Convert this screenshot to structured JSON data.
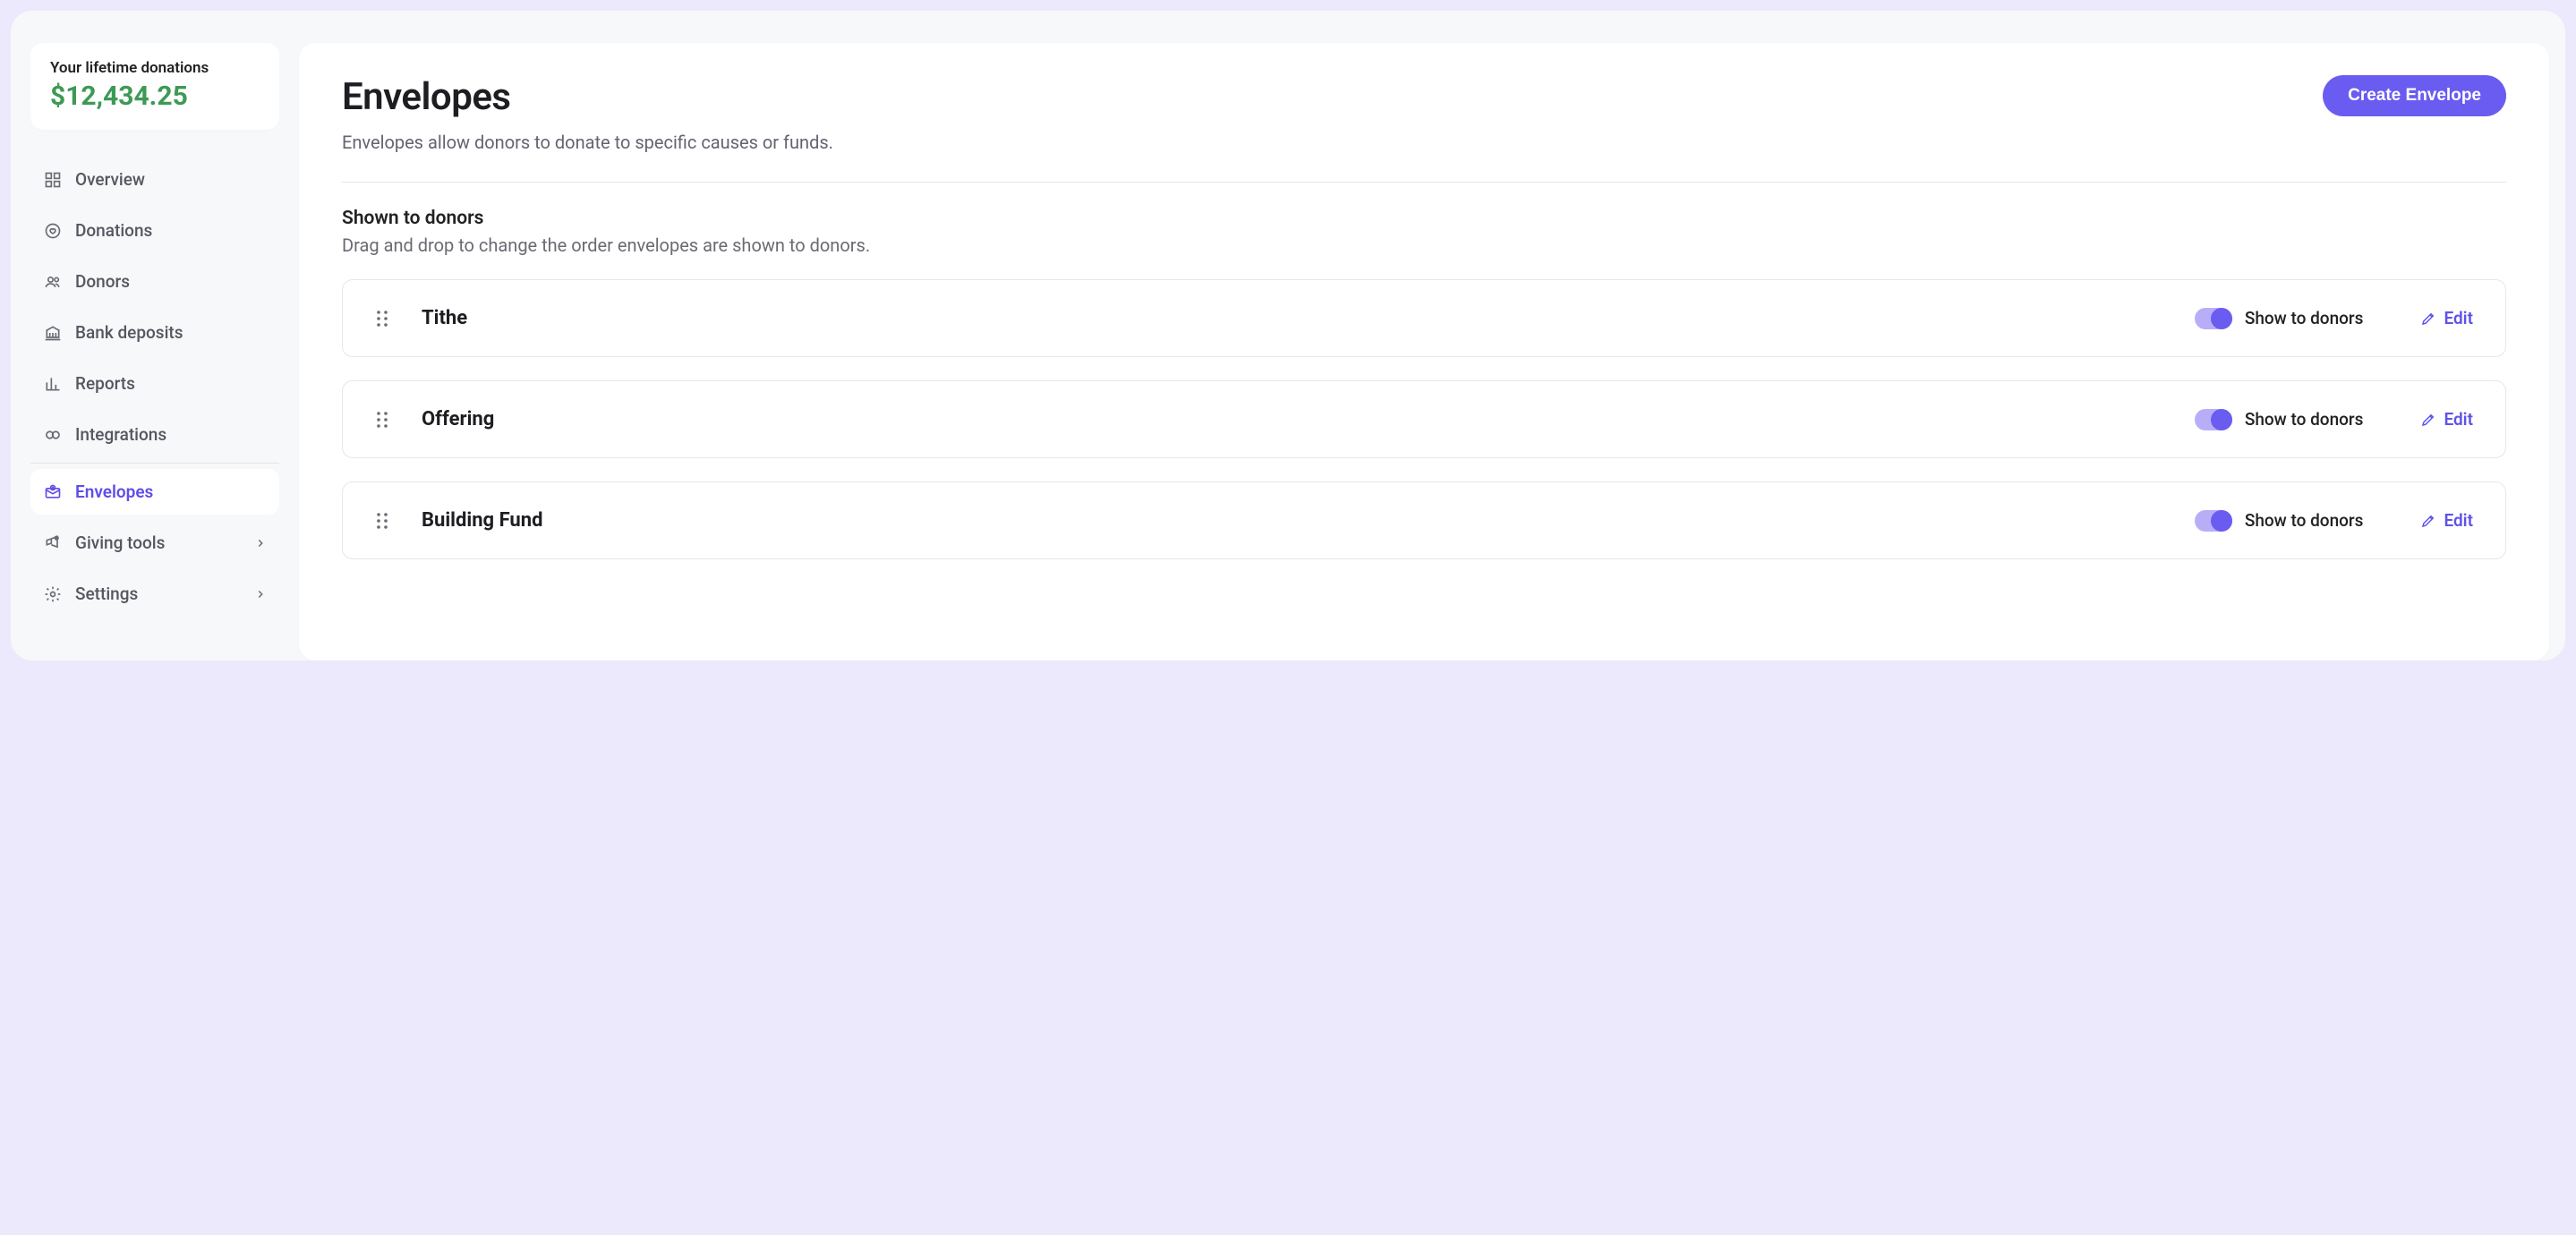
{
  "sidebar": {
    "donation_card": {
      "label": "Your lifetime donations",
      "amount": "$12,434.25"
    },
    "items": [
      {
        "id": "overview",
        "label": "Overview",
        "icon": "grid-icon",
        "expandable": false,
        "active": false
      },
      {
        "id": "donations",
        "label": "Donations",
        "icon": "heart-icon",
        "expandable": false,
        "active": false
      },
      {
        "id": "donors",
        "label": "Donors",
        "icon": "users-icon",
        "expandable": false,
        "active": false
      },
      {
        "id": "bank",
        "label": "Bank deposits",
        "icon": "bank-icon",
        "expandable": false,
        "active": false
      },
      {
        "id": "reports",
        "label": "Reports",
        "icon": "chart-icon",
        "expandable": false,
        "active": false
      },
      {
        "id": "integrations",
        "label": "Integrations",
        "icon": "link-icon",
        "expandable": false,
        "active": false
      },
      {
        "id": "envelopes",
        "label": "Envelopes",
        "icon": "envelope-icon",
        "expandable": false,
        "active": true
      },
      {
        "id": "giving",
        "label": "Giving tools",
        "icon": "megaphone-icon",
        "expandable": true,
        "active": false
      },
      {
        "id": "settings",
        "label": "Settings",
        "icon": "gear-icon",
        "expandable": true,
        "active": false
      }
    ]
  },
  "page": {
    "title": "Envelopes",
    "subtitle": "Envelopes allow donors to donate to specific causes or funds.",
    "create_button": "Create Envelope",
    "section": {
      "title": "Shown to donors",
      "help": "Drag and drop to change the order envelopes are shown to donors."
    },
    "toggle_label": "Show to donors",
    "edit_label": "Edit",
    "envelopes": [
      {
        "name": "Tithe",
        "shown": true
      },
      {
        "name": "Offering",
        "shown": true
      },
      {
        "name": "Building Fund",
        "shown": true
      }
    ]
  },
  "colors": {
    "accent": "#6a5cf0",
    "accent_soft": "#b8aef8",
    "text": "#1e1e22",
    "muted": "#6a6a74",
    "positive": "#3d9a55"
  }
}
